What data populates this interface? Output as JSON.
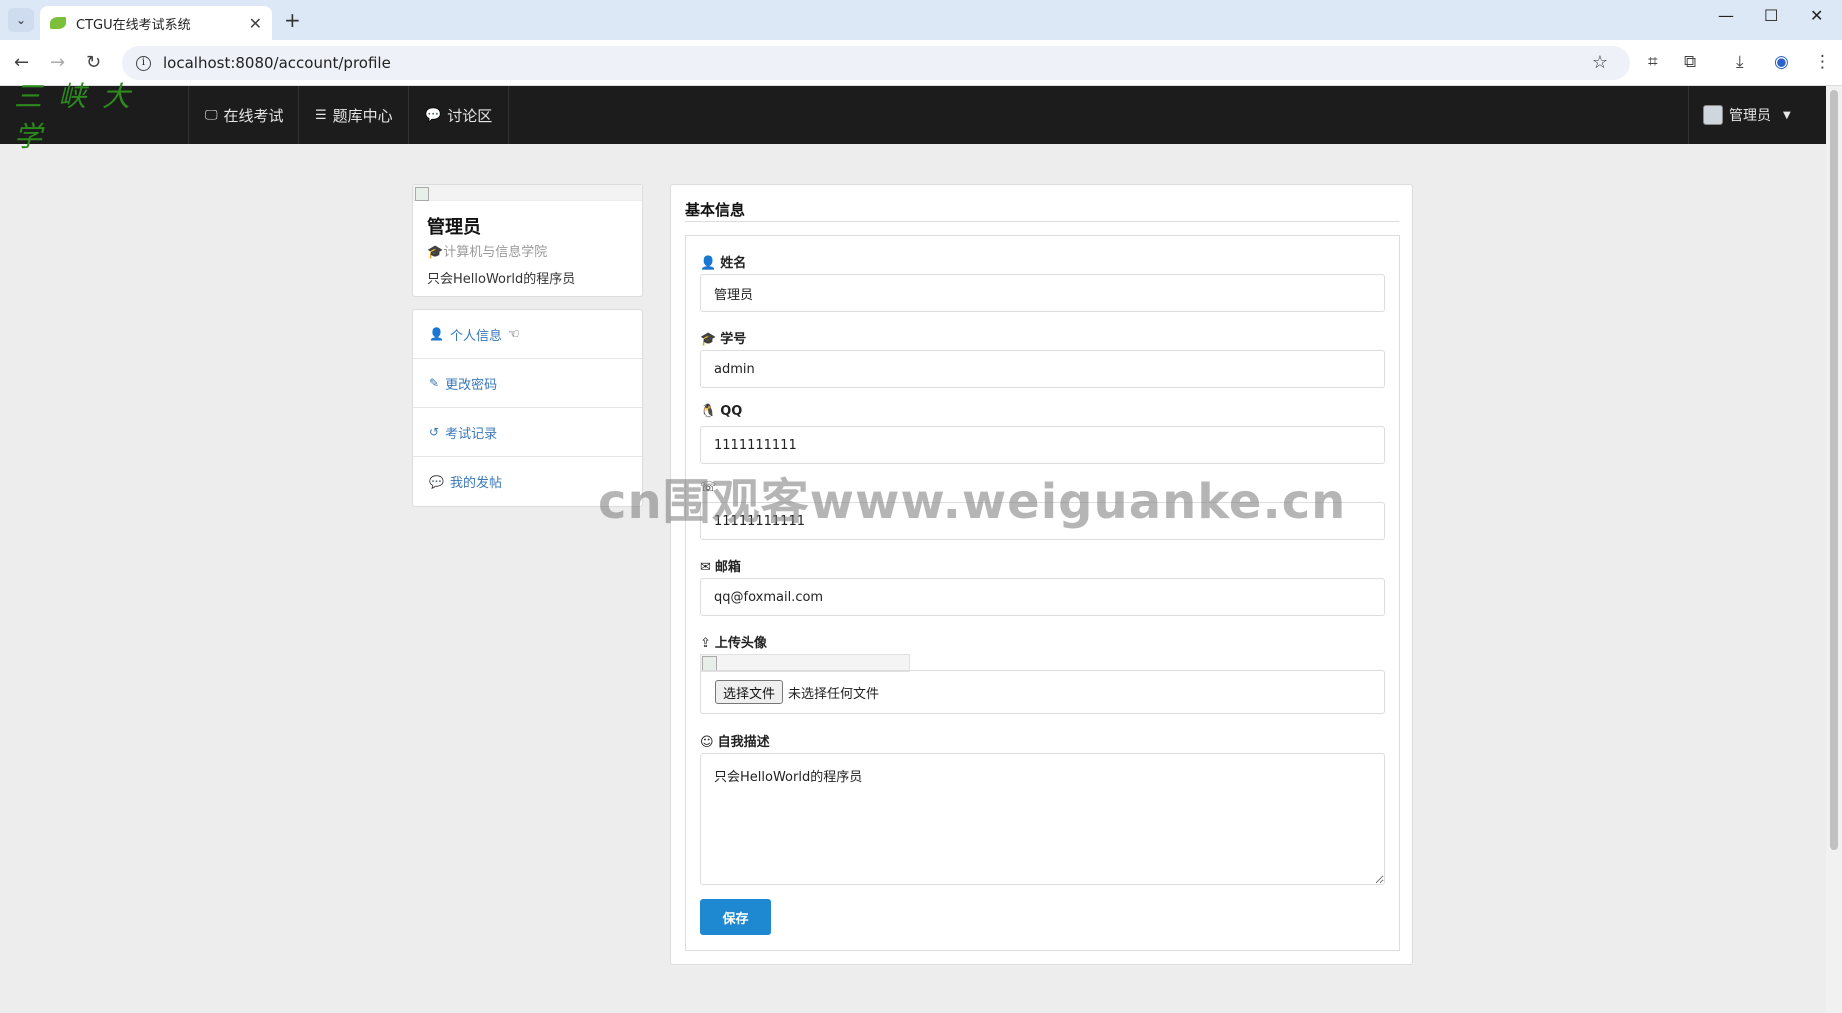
{
  "browser": {
    "tab_title": "CTGU在线考试系统",
    "url": "localhost:8080/account/profile"
  },
  "app": {
    "brand": "三峡大学",
    "nav": [
      {
        "label": "在线考试",
        "icon": "monitor-icon"
      },
      {
        "label": "题库中心",
        "icon": "list-icon"
      },
      {
        "label": "讨论区",
        "icon": "comment-icon"
      }
    ],
    "user": {
      "name": "管理员"
    }
  },
  "profile": {
    "name": "管理员",
    "college": "计算机与信息学院",
    "bio": "只会HelloWorld的程序员"
  },
  "sidemenu": [
    {
      "label": "个人信息",
      "icon": "user-icon",
      "active": true
    },
    {
      "label": "更改密码",
      "icon": "edit-icon"
    },
    {
      "label": "考试记录",
      "icon": "history-icon"
    },
    {
      "label": "我的发帖",
      "icon": "comment-icon"
    }
  ],
  "form": {
    "section_title": "基本信息",
    "name_label": "姓名",
    "name_value": "管理员",
    "student_id_label": "学号",
    "student_id_value": "admin",
    "qq_label": "QQ",
    "qq_value": "1111111111",
    "phone_value": "11111111111",
    "email_label": "邮箱",
    "email_value": "qq@foxmail.com",
    "avatar_label": "上传头像",
    "file_button": "选择文件",
    "file_status": "未选择任何文件",
    "bio_label": "自我描述",
    "bio_value": "只会HelloWorld的程序员",
    "save_label": "保存"
  },
  "watermark": "cn围观客www.weiguanke.cn"
}
